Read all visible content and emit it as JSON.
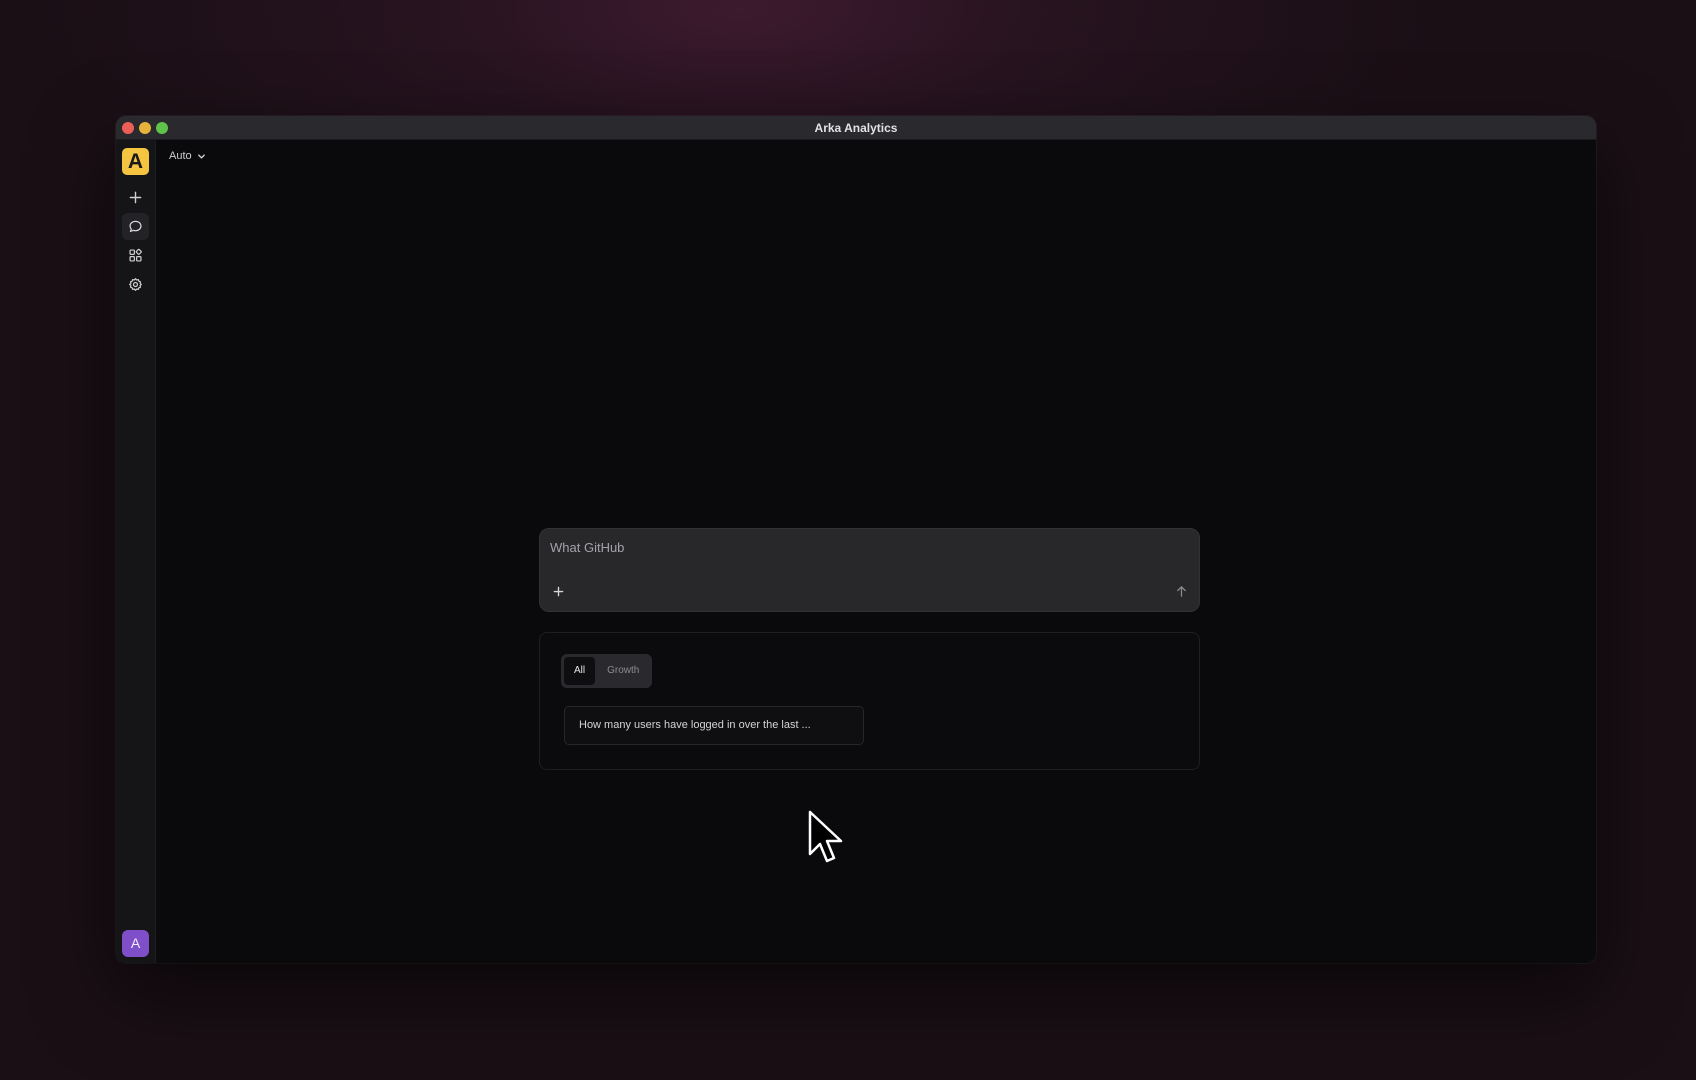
{
  "window": {
    "title": "Arka Analytics"
  },
  "sidebar": {
    "logo_letter": "A",
    "items": [
      {
        "icon": "plus-icon"
      },
      {
        "icon": "chat-bubble-icon",
        "active": true
      },
      {
        "icon": "grid-apps-icon"
      },
      {
        "icon": "gear-icon"
      }
    ],
    "avatar_letter": "A"
  },
  "header": {
    "model_label": "Auto"
  },
  "composer": {
    "value": "What GitHub",
    "placeholder": ""
  },
  "suggestions": {
    "tabs": [
      {
        "label": "All",
        "active": true
      },
      {
        "label": "Growth",
        "active": false
      }
    ],
    "cards": [
      {
        "text": "How many users have logged in over the last ..."
      }
    ]
  },
  "colors": {
    "accent_logo": "#f5c542",
    "avatar": "#7e4fc8",
    "window_bg": "#0a0a0c",
    "composer_bg": "#28282b"
  }
}
